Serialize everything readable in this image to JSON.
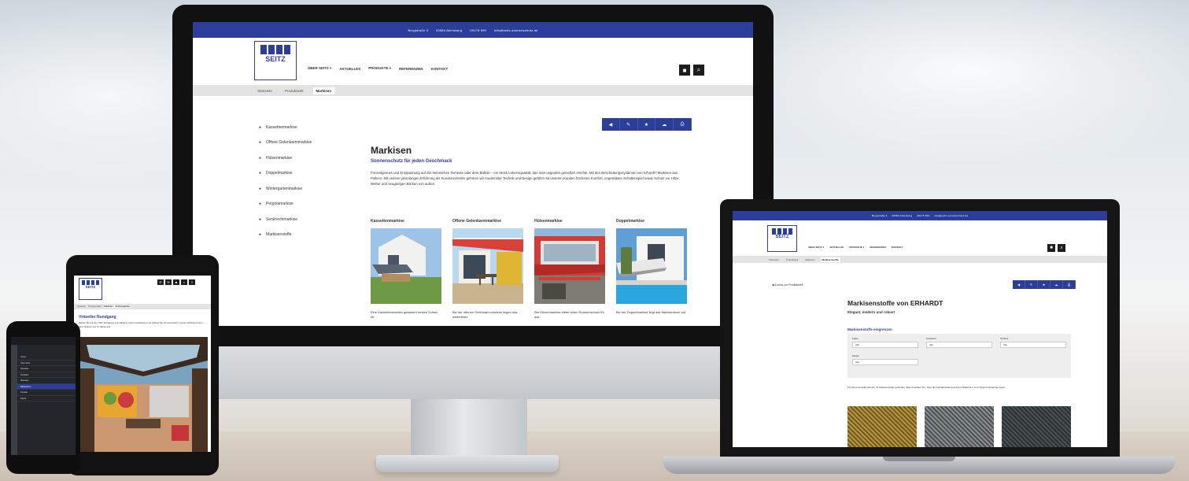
{
  "imac": {
    "topbar": {
      "address": "Bergstraße 3",
      "city": "90584 Allersberg",
      "phone": "09176 999",
      "email": "info@seitz-sonnenschutz.de"
    },
    "logo_name": "SEITZ",
    "nav": [
      "ÜBER SEITZ ▾",
      "AKTUELLES",
      "PRODUKTE ▾",
      "REFERENZEN",
      "KONTAKT"
    ],
    "cart_icon": "cart-icon",
    "search_icon": "search-icon",
    "breadcrumbs": [
      "Startseite",
      "Produktwelt",
      "Markisen"
    ],
    "sidebar": [
      "Kassettenmarkise",
      "Offene Gelenkarmmarkise",
      "Hülsenmarkise",
      "Doppelmarkise",
      "Wintergartenmarkise",
      "Pergolamarkise",
      "Senkrechtmarkise",
      "Markisenstoffe"
    ],
    "share_icons": [
      "◀",
      "✎",
      "★",
      "☁",
      "⎙"
    ],
    "title": "Markisen",
    "subtitle": "Sonnenschutz für jeden Geschmack",
    "intro": "Freizeitgenuss und Entspannung auf der heimischen Terrasse oder dem Balkon – ein Stück Lebensqualität, das man ungestört genießen möchte. Mit den Beschattungssystemen von Erhardt? Markisen aus Pollenz. Mit unserer jahrelangen Erfahrung als Kundenvertreter gehören wir modernster Technik und Design geführt mit unseren Kunden höchsten Komfort, ungetrübtes Schattenspiel sowie Schutz vor Hitze, Wetter und neugierigen Blicken von außen.",
    "cards": [
      {
        "title": "Kassettenmarkise",
        "text": "Eine Kassettenmarkise garantiert besten Schutz für"
      },
      {
        "title": "Offene Gelenkarmmarkise",
        "text": "Bei der offenen Gelenkarm-markise liegen das wetterfeste"
      },
      {
        "title": "Hülsenmarkise",
        "text": "Die Hülsenmarkise bietet einen Rundumschutz für das"
      },
      {
        "title": "Doppelmarkise",
        "text": "Bei der Doppelmarkise liegt das Markisentuch auf"
      }
    ]
  },
  "laptop": {
    "topbar": [
      "Bergstraße 3",
      "90584 Allersberg",
      "09176 999",
      "info@seitz-sonnenschutz.de"
    ],
    "logo_name": "SEITZ",
    "nav": [
      "ÜBER SEITZ ▾",
      "AKTUELLES",
      "PRODUKTE ▾",
      "REFERENZEN",
      "KONTAKT"
    ],
    "breadcrumbs": [
      "Startseite",
      "Produktwelt",
      "Markisen",
      "Markisenstoffe"
    ],
    "back_link": "◀ Zurück zur Produktwelt",
    "share_icons": [
      "◀",
      "✎",
      "★",
      "☁",
      "⎙"
    ],
    "title": "Markisenstoffe von ERHARDT",
    "subtitle": "Elegant, modern und robust",
    "filter_heading": "Markisenstoffe eingrenzen",
    "filters": [
      {
        "label": "Farbe",
        "value": "Alle"
      },
      {
        "label": "Kollektion",
        "value": "Alle"
      },
      {
        "label": "Struktur",
        "value": "Alle"
      },
      {
        "label": "Muster",
        "value": "Alle"
      }
    ],
    "note": "Für diese Auswahl wurden 41 Markisenstoffe gefunden. Bitte beachten Sie, dass die Farbdarstellung auf dem Bildschirm vom Original abweichen kann."
  },
  "tablet": {
    "logo_name": "SEITZ",
    "breadcrumbs": [
      "Startseite",
      "Terrassendach",
      "Glashaus – Sommergarten"
    ],
    "title": "Virtueller Rundgang",
    "text": "Werfen Sie mit dem 360°-Rundgang einen Blick in unsere Ausstellung und erleben Sie Sonnenschutz in seiner schönsten Form – ganz bequem von zu Hause aus."
  },
  "phone": {
    "menu": [
      "Home",
      "Über Seitz",
      "Aktuelles",
      "Produkte",
      "Markisen",
      "Referenzen",
      "Kontakt",
      "Suche"
    ],
    "active_index": 5
  },
  "colors": {
    "brand_blue": "#2d3d9a",
    "header_gray": "#e3e3e3"
  }
}
